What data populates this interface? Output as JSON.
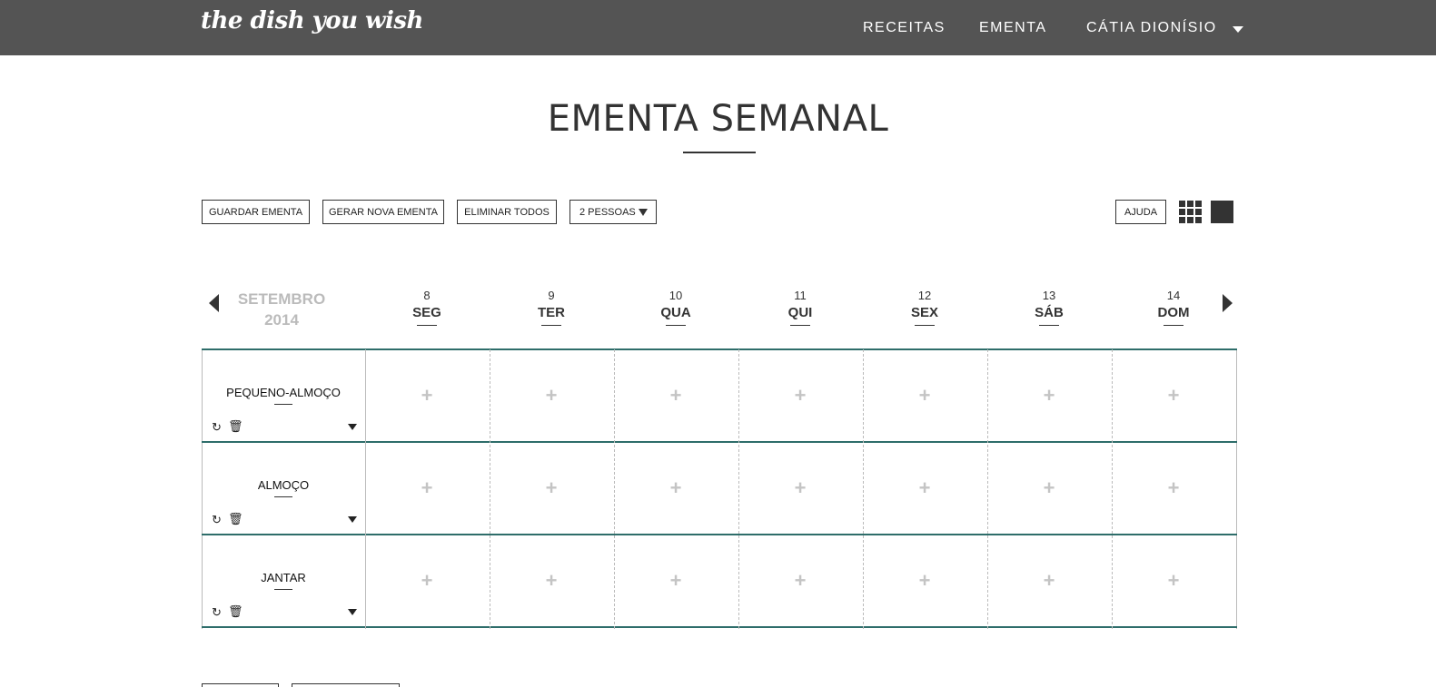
{
  "header": {
    "logo": "the dish you wish",
    "nav": [
      "RECEITAS",
      "EMENTA",
      "CÁTIA DIONÍSIO"
    ]
  },
  "page": {
    "title": "EMENTA SEMANAL"
  },
  "toolbar": {
    "guardar": "GUARDAR EMENTA",
    "gerar": "GERAR NOVA EMENTA",
    "eliminar": "ELIMINAR TODOS",
    "pessoas": "2 PESSOAS",
    "ajuda": "AJUDA"
  },
  "calendar": {
    "month": "SETEMBRO",
    "year": "2014",
    "days": [
      {
        "num": "8",
        "name": "SEG"
      },
      {
        "num": "9",
        "name": "TER"
      },
      {
        "num": "10",
        "name": "QUA"
      },
      {
        "num": "11",
        "name": "QUI"
      },
      {
        "num": "12",
        "name": "SEX"
      },
      {
        "num": "13",
        "name": "SÁB"
      },
      {
        "num": "14",
        "name": "DOM"
      }
    ]
  },
  "meals": [
    "PEQUENO-ALMOÇO",
    "ALMOÇO",
    "JANTAR"
  ],
  "colors": {
    "topbar": "#545454",
    "row_line": "#2e6d6a",
    "plus": "#c4c4c4"
  }
}
